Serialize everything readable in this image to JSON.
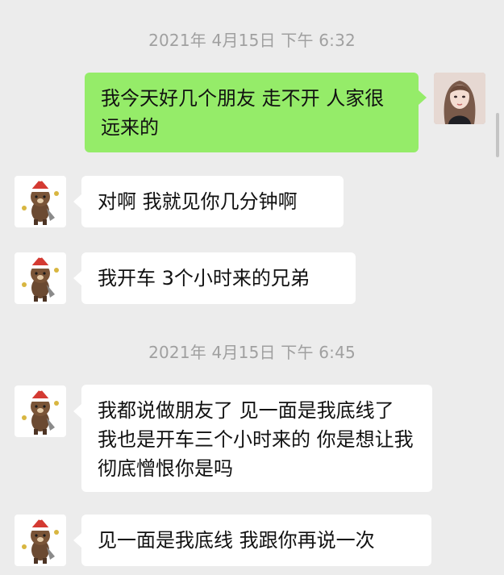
{
  "chat": {
    "timestamps": [
      "2021年 4月15日 下午 6:32",
      "2021年 4月15日 下午 6:45"
    ],
    "messages": [
      {
        "side": "right",
        "text": "我今天好几个朋友 走不开 人家很远来的"
      },
      {
        "side": "left",
        "text": "对啊 我就见你几分钟啊"
      },
      {
        "side": "left",
        "text": "我开车 3个小时来的兄弟"
      },
      {
        "side": "left",
        "text": "我都说做朋友了 见一面是我底线了 我也是开车三个小时来的 你是想让我彻底憎恨你是吗"
      },
      {
        "side": "left",
        "text": "见一面是我底线 我跟你再说一次"
      }
    ]
  },
  "colors": {
    "background": "#ececec",
    "sent_bubble": "#95ec69",
    "received_bubble": "#ffffff",
    "timestamp_text": "#a0a0a0"
  },
  "icons": {
    "self_avatar": "girl-avatar-icon",
    "contact_avatar": "bear-avatar-icon"
  }
}
